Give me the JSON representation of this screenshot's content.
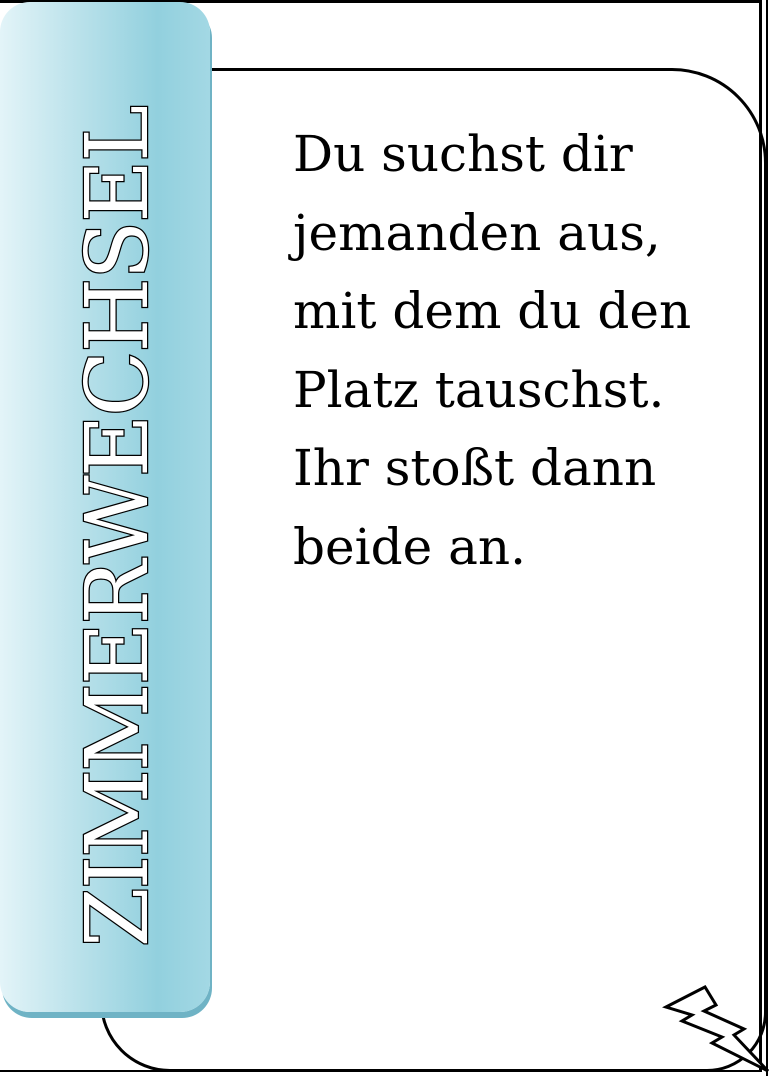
{
  "card": {
    "title": "ZIMMERWECHSEL",
    "lines": [
      "Du suchst dir",
      "jemanden aus,",
      "mit dem du den",
      "Platz tauschst.",
      "Ihr stoßt dann",
      "beide an."
    ]
  },
  "icons": {
    "corner": "lightning-bolt-icon"
  },
  "colors": {
    "tab_light": "#e3f4f8",
    "tab_dark": "#92d0de",
    "tab_shadow": "#6fb3c5",
    "text": "#000000"
  }
}
